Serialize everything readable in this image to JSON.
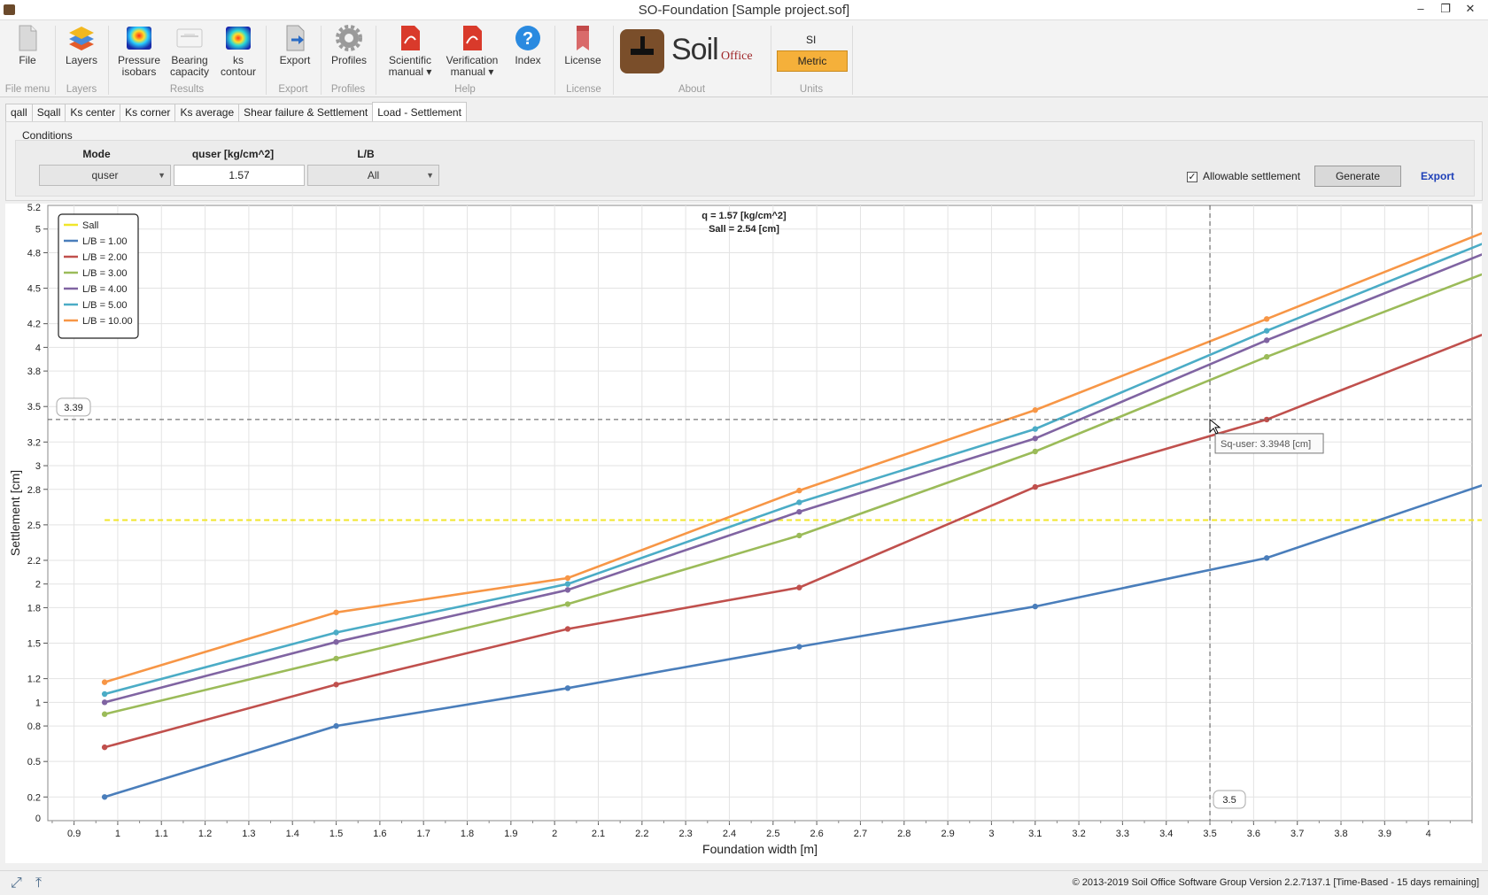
{
  "window": {
    "title": "SO-Foundation [Sample project.sof]"
  },
  "ribbon": {
    "buttons": [
      {
        "id": "file",
        "label": "File"
      },
      {
        "id": "layers",
        "label": "Layers"
      },
      {
        "id": "pressure",
        "label": "Pressure isobars",
        "l1": "Pressure",
        "l2": "isobars"
      },
      {
        "id": "bearing",
        "label": "Bearing capacity",
        "l1": "Bearing",
        "l2": "capacity"
      },
      {
        "id": "ks",
        "label": "ks contour",
        "l1": "ks",
        "l2": "contour"
      },
      {
        "id": "export",
        "label": "Export"
      },
      {
        "id": "profiles",
        "label": "Profiles"
      },
      {
        "id": "sci",
        "l1": "Scientific",
        "l2": "manual ▾"
      },
      {
        "id": "ver",
        "l1": "Verification",
        "l2": "manual ▾"
      },
      {
        "id": "index",
        "label": "Index"
      },
      {
        "id": "license",
        "label": "License"
      }
    ],
    "groups": [
      "File menu",
      "Layers",
      "Results",
      "Export",
      "Profiles",
      "Help",
      "License",
      "About",
      "Units"
    ],
    "units": {
      "system": "SI",
      "active": "Metric"
    },
    "logo": {
      "l1": "Soil",
      "l2": "Office"
    }
  },
  "tabs": [
    "qall",
    "Sqall",
    "Ks center",
    "Ks corner",
    "Ks average",
    "Shear failure & Settlement",
    "Load - Settlement"
  ],
  "active_tab": "Load - Settlement",
  "conditions": {
    "title": "Conditions",
    "mode_label": "Mode",
    "mode_value": "quser",
    "quser_label": "quser [kg/cm^2]",
    "quser_value": "1.57",
    "lb_label": "L/B",
    "lb_value": "All",
    "allowable_label": "Allowable settlement",
    "allowable_checked": true,
    "generate_label": "Generate",
    "export_label": "Export"
  },
  "chart_data": {
    "type": "line",
    "title_line1": "q = 1.57 [kg/cm^2]",
    "title_line2": "Sall = 2.54 [cm]",
    "xlabel": "Foundation width [m]",
    "ylabel": "Settlement [cm]",
    "xlim": [
      0.84,
      4.1
    ],
    "ylim": [
      0,
      5.2
    ],
    "xticks": [
      "0.9",
      "1",
      "1.1",
      "1.2",
      "1.3",
      "1.4",
      "1.5",
      "1.6",
      "1.7",
      "1.8",
      "1.9",
      "2",
      "2.1",
      "2.2",
      "2.3",
      "2.4",
      "2.5",
      "2.6",
      "2.7",
      "2.8",
      "2.9",
      "3",
      "3.1",
      "3.2",
      "3.3",
      "3.4",
      "3.5",
      "3.6",
      "3.7",
      "3.8",
      "3.9",
      "4"
    ],
    "yticks": [
      "0.2",
      "0.5",
      "0.8",
      "1",
      "1.2",
      "1.5",
      "1.8",
      "2",
      "2.2",
      "2.5",
      "2.8",
      "3",
      "3.2",
      "3.5",
      "3.8",
      "4",
      "4.2",
      "4.5",
      "4.8",
      "5"
    ],
    "yticks_clipped": [
      "0",
      "5.2"
    ],
    "grid": true,
    "legend_position": "top-left",
    "x": [
      0.97,
      1.5,
      2.03,
      2.56,
      3.1,
      3.63,
      4.16
    ],
    "sall": {
      "name": "Sall",
      "value": 2.54,
      "color": "#f0e62a"
    },
    "series": [
      {
        "name": "L/B = 1.00",
        "color": "#4a7ebb",
        "values": [
          0.2,
          0.8,
          1.12,
          1.47,
          1.81,
          2.22,
          2.88
        ]
      },
      {
        "name": "L/B = 2.00",
        "color": "#c0504d",
        "values": [
          0.62,
          1.15,
          1.62,
          1.97,
          2.82,
          3.39,
          4.16
        ]
      },
      {
        "name": "L/B = 3.00",
        "color": "#9bbb59",
        "values": [
          0.9,
          1.37,
          1.83,
          2.41,
          3.12,
          3.92,
          4.67
        ]
      },
      {
        "name": "L/B = 4.00",
        "color": "#8064a2",
        "values": [
          1.0,
          1.51,
          1.95,
          2.61,
          3.23,
          4.06,
          4.84
        ]
      },
      {
        "name": "L/B = 5.00",
        "color": "#4bacc6",
        "values": [
          1.07,
          1.59,
          2.0,
          2.69,
          3.31,
          4.14,
          4.93
        ]
      },
      {
        "name": "L/B = 10.00",
        "color": "#f79646",
        "values": [
          1.17,
          1.76,
          2.05,
          2.79,
          3.47,
          4.24,
          5.02
        ]
      }
    ],
    "crosshair": {
      "x": 3.5,
      "y": 3.39,
      "x_label": "3.5",
      "y_label": "3.39",
      "tooltip": "Sq-user: 3.3948 [cm]"
    }
  },
  "status": {
    "copyright": "© 2013-2019  Soil Office Software Group    Version 2.2.7137.1 [Time-Based - 15 days remaining]"
  }
}
